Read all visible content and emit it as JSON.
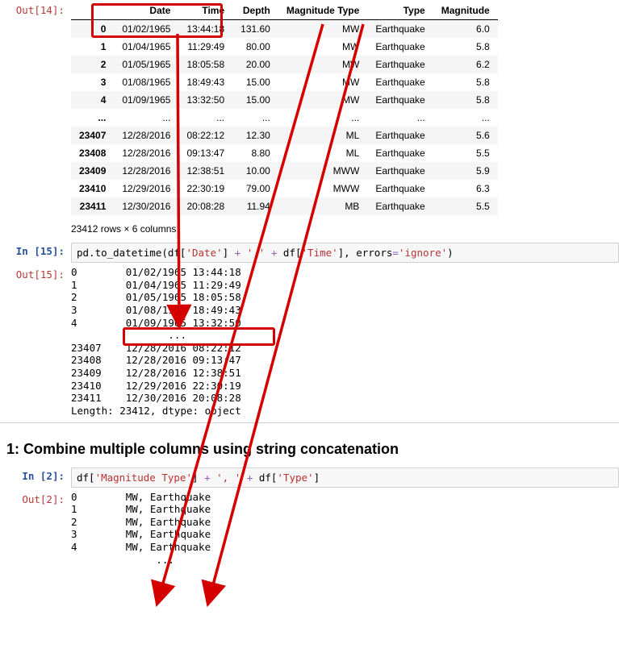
{
  "out14": {
    "prompt": "Out[14]:",
    "columns": [
      "Date",
      "Time",
      "Depth",
      "Magnitude Type",
      "Type",
      "Magnitude"
    ],
    "rows": [
      {
        "idx": "0",
        "Date": "01/02/1965",
        "Time": "13:44:18",
        "Depth": "131.60",
        "MagType": "MW",
        "Type": "Earthquake",
        "Mag": "6.0"
      },
      {
        "idx": "1",
        "Date": "01/04/1965",
        "Time": "11:29:49",
        "Depth": "80.00",
        "MagType": "MW",
        "Type": "Earthquake",
        "Mag": "5.8"
      },
      {
        "idx": "2",
        "Date": "01/05/1965",
        "Time": "18:05:58",
        "Depth": "20.00",
        "MagType": "MW",
        "Type": "Earthquake",
        "Mag": "6.2"
      },
      {
        "idx": "3",
        "Date": "01/08/1965",
        "Time": "18:49:43",
        "Depth": "15.00",
        "MagType": "MW",
        "Type": "Earthquake",
        "Mag": "5.8"
      },
      {
        "idx": "4",
        "Date": "01/09/1965",
        "Time": "13:32:50",
        "Depth": "15.00",
        "MagType": "MW",
        "Type": "Earthquake",
        "Mag": "5.8"
      },
      {
        "idx": "...",
        "Date": "...",
        "Time": "...",
        "Depth": "...",
        "MagType": "...",
        "Type": "...",
        "Mag": "..."
      },
      {
        "idx": "23407",
        "Date": "12/28/2016",
        "Time": "08:22:12",
        "Depth": "12.30",
        "MagType": "ML",
        "Type": "Earthquake",
        "Mag": "5.6"
      },
      {
        "idx": "23408",
        "Date": "12/28/2016",
        "Time": "09:13:47",
        "Depth": "8.80",
        "MagType": "ML",
        "Type": "Earthquake",
        "Mag": "5.5"
      },
      {
        "idx": "23409",
        "Date": "12/28/2016",
        "Time": "12:38:51",
        "Depth": "10.00",
        "MagType": "MWW",
        "Type": "Earthquake",
        "Mag": "5.9"
      },
      {
        "idx": "23410",
        "Date": "12/29/2016",
        "Time": "22:30:19",
        "Depth": "79.00",
        "MagType": "MWW",
        "Type": "Earthquake",
        "Mag": "6.3"
      },
      {
        "idx": "23411",
        "Date": "12/30/2016",
        "Time": "20:08:28",
        "Depth": "11.94",
        "MagType": "MB",
        "Type": "Earthquake",
        "Mag": "5.5"
      }
    ],
    "footer": "23412 rows × 6 columns"
  },
  "in15": {
    "prompt": "In [15]:",
    "code_parts": [
      "pd.to_datetime(df[",
      "'Date'",
      "] ",
      "+",
      " ",
      "' '",
      " ",
      "+",
      " df[",
      "'Time'",
      "], errors",
      "=",
      "'ignore'",
      ")"
    ]
  },
  "out15": {
    "prompt": "Out[15]:",
    "lines": [
      "0        01/02/1965 13:44:18",
      "1        01/04/1965 11:29:49",
      "2        01/05/1965 18:05:58",
      "3        01/08/1965 18:49:43",
      "4        01/09/1965 13:32:50",
      "                ...         ",
      "23407    12/28/2016 08:22:12",
      "23408    12/28/2016 09:13:47",
      "23409    12/28/2016 12:38:51",
      "23410    12/29/2016 22:30:19",
      "23411    12/30/2016 20:08:28",
      "Length: 23412, dtype: object"
    ]
  },
  "heading1": "1: Combine multiple columns using string concatenation",
  "in2": {
    "prompt": "In [2]:",
    "code_parts": [
      "df[",
      "'Magnitude Type'",
      "] ",
      "+",
      " ",
      "', '",
      " ",
      "+",
      " df[",
      "'Type'",
      "]"
    ]
  },
  "out2": {
    "prompt": "Out[2]:",
    "lines": [
      "0        MW, Earthquake",
      "1        MW, Earthquake",
      "2        MW, Earthquake",
      "3        MW, Earthquake",
      "4        MW, Earthquake",
      "              ...      "
    ]
  }
}
